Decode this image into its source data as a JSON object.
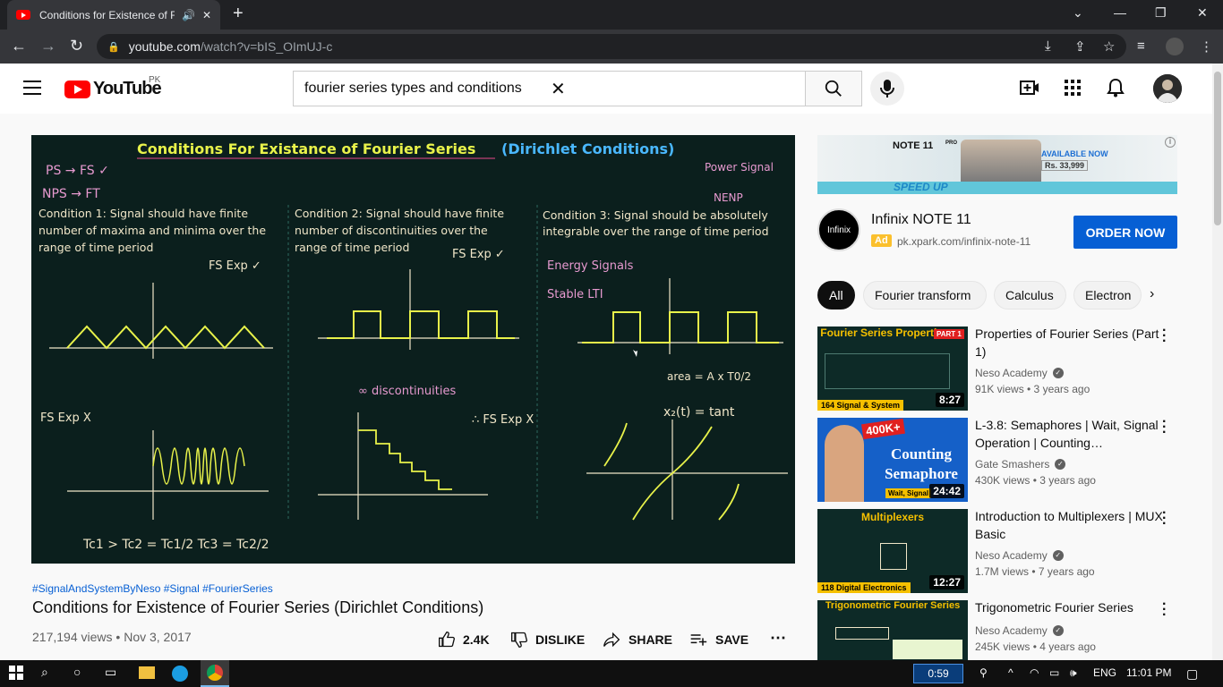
{
  "browser": {
    "tab_title": "Conditions for Existence of F",
    "url_host": "youtube.com",
    "url_path": "/watch?v=bIS_OImUJ-c"
  },
  "header": {
    "logo_text": "YouTube",
    "region": "PK",
    "search_value": "fourier series types and conditions"
  },
  "video": {
    "board_title": "Conditions For Existance of Fourier Series",
    "board_title_paren": "(Dirichlet Conditions)",
    "board_cond1_a": "Condition 1: Signal should have finite",
    "board_cond1_b": "number of maxima and minima over the",
    "board_cond1_c": "range of time period",
    "board_cond2_a": "Condition 2: Signal should have finite",
    "board_cond2_b": "number of discontinuities over the",
    "board_cond2_c": "range of time period",
    "board_cond3_a": "Condition 3: Signal should be absolutely",
    "board_cond3_b": "integrable over the range of time period",
    "board_ps_fs": "PS → FS ✓",
    "board_nps_ft": "NPS → FT",
    "board_fs_exp1": "FS Exp ✓",
    "board_fs_exp2": "FS Exp ✓",
    "board_fs_expx": "FS Exp X",
    "board_fs_expx2": "∴ FS Exp X",
    "board_discont": "∞ discontinuities",
    "board_energy": "Energy Signals",
    "board_stable": "Stable LTI",
    "board_power": "Power Signal",
    "board_nenp": "NENP",
    "board_area": "area = A x T0/2",
    "board_x2": "x₂(t) = tant",
    "board_tc": "Tc1 > Tc2 = Tc1/2   Tc3 = Tc2/2",
    "hashtags": "#SignalAndSystemByNeso #Signal #FourierSeries",
    "title": "Conditions for Existence of Fourier Series (Dirichlet Conditions)",
    "views": "217,194 views",
    "date": "Nov 3, 2017",
    "likes": "2.4K",
    "dislike_label": "DISLIKE",
    "share_label": "SHARE",
    "save_label": "SAVE"
  },
  "ad": {
    "banner_brand": "NOTE 11",
    "banner_pro": "PRO",
    "banner_available": "AVAILABLE NOW",
    "banner_price": "Rs. 33,999",
    "banner_speed": "SPEED UP",
    "logo_text": "Infinix",
    "title": "Infinix NOTE 11",
    "badge": "Ad",
    "url": "pk.xpark.com/infinix-note-11",
    "cta": "ORDER NOW"
  },
  "chips": [
    "All",
    "Fourier transform",
    "Calculus",
    "Electron"
  ],
  "recommendations": [
    {
      "thumb_title": "Fourier Series Properties",
      "thumb_badge": "PART 1",
      "thumb_footer": "164 Signal & System",
      "title": "Properties of Fourier Series (Part 1)",
      "channel": "Neso Academy",
      "meta": "91K views • 3 years ago",
      "duration": "8:27",
      "bg": "#0d2a27",
      "footer_color": "#f5c000"
    },
    {
      "thumb_title": "Counting Semaphore",
      "thumb_badge": "400K+",
      "thumb_footer": "Wait, Signal",
      "title": "L-3.8: Semaphores | Wait, Signal Operation | Counting…",
      "channel": "Gate Smashers",
      "meta": "430K views • 3 years ago",
      "duration": "24:42",
      "bg": "#1560c8",
      "footer_color": "#f5c000"
    },
    {
      "thumb_title": "Multiplexers",
      "thumb_badge": "",
      "thumb_footer": "118 Digital Electronics",
      "title": "Introduction to Multiplexers | MUX Basic",
      "channel": "Neso Academy",
      "meta": "1.7M views • 7 years ago",
      "duration": "12:27",
      "bg": "#0d2a27",
      "footer_color": "#f5c000"
    },
    {
      "thumb_title": "Trigonometric Fourier Series",
      "thumb_badge": "",
      "thumb_footer": "",
      "title": "Trigonometric Fourier Series",
      "channel": "Neso Academy",
      "meta": "245K views • 4 years ago",
      "duration": "",
      "bg": "#0d2a27",
      "footer_color": "#f5c000"
    }
  ],
  "taskbar": {
    "timer": "0:59",
    "lang": "ENG",
    "time": "11:01 PM"
  }
}
